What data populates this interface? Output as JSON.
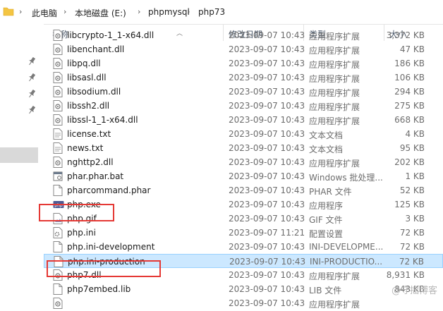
{
  "breadcrumb": {
    "items": [
      "此电脑",
      "本地磁盘 (E:)",
      "phpmysql",
      "php73"
    ],
    "separator": "›"
  },
  "columns": {
    "name": "名称",
    "date": "修改日期",
    "type": "类型",
    "size": "大小"
  },
  "files": [
    {
      "name": "libcrypto-1_1-x64.dll",
      "date": "2023-09-07 10:43",
      "type": "应用程序扩展",
      "size": "3,372 KB",
      "icon": "dll-icon"
    },
    {
      "name": "libenchant.dll",
      "date": "2023-09-07 10:43",
      "type": "应用程序扩展",
      "size": "47 KB",
      "icon": "dll-icon"
    },
    {
      "name": "libpq.dll",
      "date": "2023-09-07 10:43",
      "type": "应用程序扩展",
      "size": "186 KB",
      "icon": "dll-icon"
    },
    {
      "name": "libsasl.dll",
      "date": "2023-09-07 10:43",
      "type": "应用程序扩展",
      "size": "106 KB",
      "icon": "dll-icon"
    },
    {
      "name": "libsodium.dll",
      "date": "2023-09-07 10:43",
      "type": "应用程序扩展",
      "size": "294 KB",
      "icon": "dll-icon"
    },
    {
      "name": "libssh2.dll",
      "date": "2023-09-07 10:43",
      "type": "应用程序扩展",
      "size": "275 KB",
      "icon": "dll-icon"
    },
    {
      "name": "libssl-1_1-x64.dll",
      "date": "2023-09-07 10:43",
      "type": "应用程序扩展",
      "size": "668 KB",
      "icon": "dll-icon"
    },
    {
      "name": "license.txt",
      "date": "2023-09-07 10:43",
      "type": "文本文档",
      "size": "4 KB",
      "icon": "text-file-icon"
    },
    {
      "name": "news.txt",
      "date": "2023-09-07 10:43",
      "type": "文本文档",
      "size": "95 KB",
      "icon": "text-file-icon"
    },
    {
      "name": "nghttp2.dll",
      "date": "2023-09-07 10:43",
      "type": "应用程序扩展",
      "size": "202 KB",
      "icon": "dll-icon"
    },
    {
      "name": "phar.phar.bat",
      "date": "2023-09-07 10:43",
      "type": "Windows 批处理...",
      "size": "1 KB",
      "icon": "batch-file-icon"
    },
    {
      "name": "pharcommand.phar",
      "date": "2023-09-07 10:43",
      "type": "PHAR 文件",
      "size": "52 KB",
      "icon": "blank-file-icon"
    },
    {
      "name": "php.exe",
      "date": "2023-09-07 10:43",
      "type": "应用程序",
      "size": "125 KB",
      "icon": "php-exe-icon"
    },
    {
      "name": "php.gif",
      "date": "2023-09-07 10:43",
      "type": "GIF 文件",
      "size": "3 KB",
      "icon": "image-file-icon"
    },
    {
      "name": "php.ini",
      "date": "2023-09-07 11:21",
      "type": "配置设置",
      "size": "72 KB",
      "icon": "config-file-icon"
    },
    {
      "name": "php.ini-development",
      "date": "2023-09-07 10:43",
      "type": "INI-DEVELOPME...",
      "size": "72 KB",
      "icon": "blank-file-icon"
    },
    {
      "name": "php.ini-production",
      "date": "2023-09-07 10:43",
      "type": "INI-PRODUCTIO...",
      "size": "72 KB",
      "icon": "blank-file-icon",
      "selected": true
    },
    {
      "name": "php7.dll",
      "date": "2023-09-07 10:43",
      "type": "应用程序扩展",
      "size": "8,931 KB",
      "icon": "dll-icon"
    },
    {
      "name": "php7embed.lib",
      "date": "2023-09-07 10:43",
      "type": "LIB 文件",
      "size": "843 KB",
      "icon": "blank-file-icon"
    },
    {
      "name": "",
      "date": "2023-09-07 10:43",
      "type": "应用程序扩展",
      "size": "",
      "icon": "dll-icon"
    }
  ],
  "watermark": "@守拙博客",
  "colors": {
    "selection_bg": "#cce8ff",
    "selection_border": "#99d1ff",
    "highlight_box": "#e53935",
    "folder": "#f4c542"
  }
}
